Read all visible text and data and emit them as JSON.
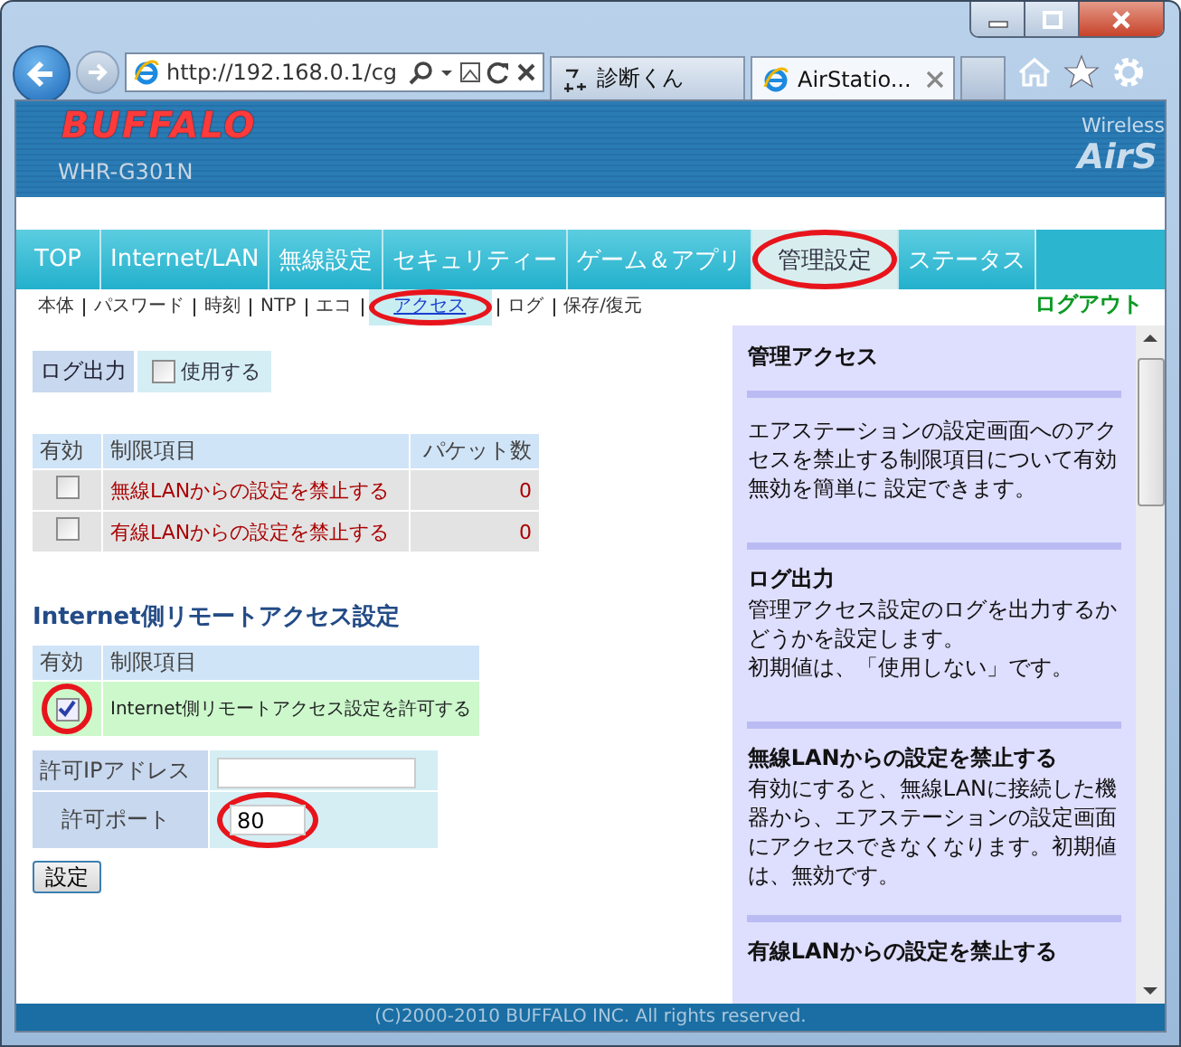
{
  "browser": {
    "address": "http://192.168.0.1/cg",
    "tabs": [
      {
        "label": "診断くん",
        "selected": false
      },
      {
        "label": "AirStatio...",
        "selected": true
      }
    ]
  },
  "header": {
    "logo": "BUFFALO",
    "model": "WHR-G301N",
    "product_line": "Wireless",
    "product_name": "AirS"
  },
  "main_tabs": [
    {
      "label": "TOP",
      "selected": false
    },
    {
      "label": "Internet/LAN",
      "selected": false
    },
    {
      "label": "無線設定",
      "selected": false
    },
    {
      "label": "セキュリティー",
      "selected": false
    },
    {
      "label": "ゲーム＆アプリ",
      "selected": false
    },
    {
      "label": "管理設定",
      "selected": true,
      "circled": true
    },
    {
      "label": "ステータス",
      "selected": false
    }
  ],
  "logout": "ログアウト",
  "sub_tabs": [
    {
      "label": "本体",
      "selected": false
    },
    {
      "label": "パスワード",
      "selected": false
    },
    {
      "label": "時刻",
      "selected": false
    },
    {
      "label": "NTP",
      "selected": false
    },
    {
      "label": "エコ",
      "selected": false
    },
    {
      "label": "アクセス",
      "selected": true,
      "circled": true
    },
    {
      "label": "ログ",
      "selected": false
    },
    {
      "label": "保存/復元",
      "selected": false
    }
  ],
  "log_output": {
    "label": "ログ出力",
    "option": "使用する",
    "checked": false
  },
  "restrictions": {
    "columns": [
      "有効",
      "制限項目",
      "パケット数"
    ],
    "rows": [
      {
        "checked": false,
        "item": "無線LANからの設定を禁止する",
        "packets": "0"
      },
      {
        "checked": false,
        "item": "有線LANからの設定を禁止する",
        "packets": "0"
      }
    ]
  },
  "remote": {
    "title": "Internet側リモートアクセス設定",
    "columns": [
      "有効",
      "制限項目"
    ],
    "rows": [
      {
        "checked": true,
        "circled": true,
        "item": "Internet側リモートアクセス設定を許可する"
      }
    ],
    "fields": [
      {
        "label": "許可IPアドレス",
        "circled": false
      },
      {
        "label": "許可ポート",
        "value": "80",
        "circled": true
      }
    ],
    "button": "設定"
  },
  "help": [
    {
      "title": "管理アクセス",
      "body": [
        "エアステーションの設定画面へのアクセスを禁止する制限項目について有効無効を簡単に 設定できます。"
      ]
    },
    {
      "title": "ログ出力",
      "body": [
        "管理アクセス設定のログを出力するかどうかを設定します。",
        "初期値は、「使用しない」です。"
      ]
    },
    {
      "title": "無線LANからの設定を禁止する",
      "body": [
        "有効にすると、無線LANに接続した機器から、エアステーションの設定画面にアクセスできなくなります。初期値は、無効です。"
      ]
    },
    {
      "title": "有線LANからの設定を禁止する"
    }
  ],
  "footer": "(C)2000-2010 BUFFALO INC. All rights reserved."
}
